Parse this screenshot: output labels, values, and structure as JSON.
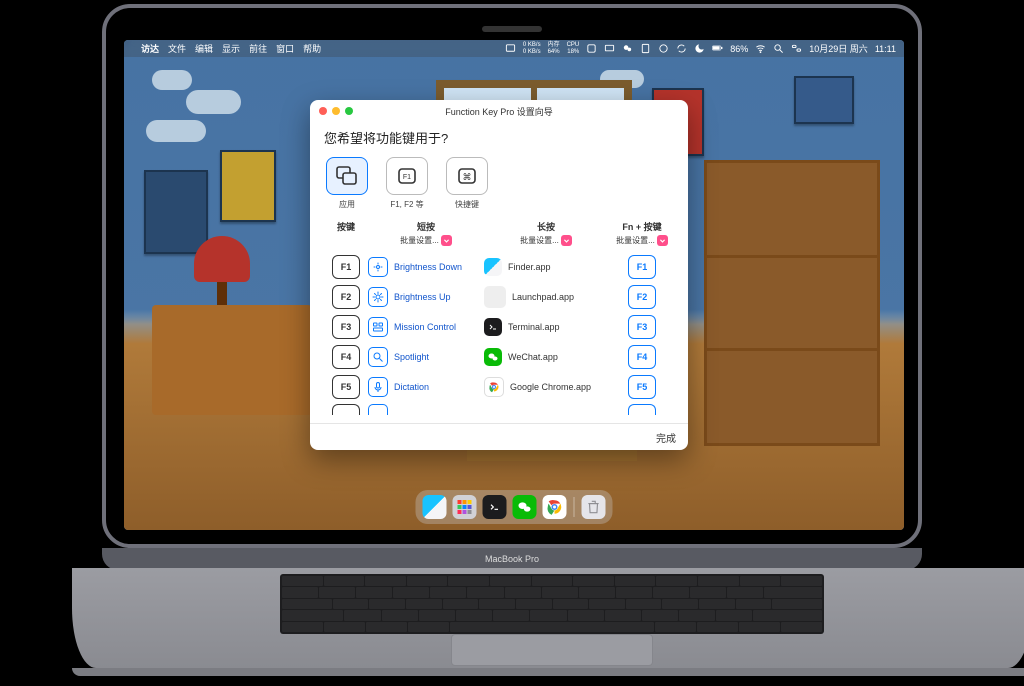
{
  "menubar": {
    "apple": "",
    "app": "访达",
    "items": [
      "文件",
      "编辑",
      "显示",
      "前往",
      "窗口",
      "帮助"
    ],
    "stats": {
      "net": {
        "up": "0 KB/s",
        "down": "0 KB/s"
      },
      "mem": {
        "label": "内存",
        "value": "64%"
      },
      "cpu": {
        "label": "CPU",
        "value": "18%"
      }
    },
    "battery": "86%",
    "date": "10月29日 周六",
    "time": "11:11"
  },
  "window": {
    "title": "Function Key Pro 设置向导",
    "heading": "您希望将功能键用于?",
    "modes": [
      {
        "label": "应用",
        "selected": true
      },
      {
        "label": "F1, F2 等"
      },
      {
        "label": "快捷键"
      }
    ],
    "columns": {
      "key": "按键",
      "short": "短按",
      "long": "长按",
      "fn": "Fn + 按键"
    },
    "batch_label": "批量设置...",
    "rows": [
      {
        "key": "F1",
        "short": "Brightness Down",
        "long": "Finder.app",
        "long_icon": "finder",
        "fn": "F1"
      },
      {
        "key": "F2",
        "short": "Brightness Up",
        "long": "Launchpad.app",
        "long_icon": "launchpad",
        "fn": "F2"
      },
      {
        "key": "F3",
        "short": "Mission Control",
        "long": "Terminal.app",
        "long_icon": "terminal",
        "fn": "F3"
      },
      {
        "key": "F4",
        "short": "Spotlight",
        "long": "WeChat.app",
        "long_icon": "wechat",
        "fn": "F4"
      },
      {
        "key": "F5",
        "short": "Dictation",
        "long": "Google Chrome.app",
        "long_icon": "chrome",
        "fn": "F5"
      }
    ],
    "done": "完成"
  },
  "dock": {
    "items": [
      {
        "name": "finder",
        "bg": "#0a84ff"
      },
      {
        "name": "launchpad",
        "bg": "#8e8e93"
      },
      {
        "name": "terminal",
        "bg": "#1c1c1e"
      },
      {
        "name": "wechat",
        "bg": "#09bb07"
      },
      {
        "name": "chrome",
        "bg": "#ffffff"
      },
      {
        "name": "trash",
        "bg": "#d1d1d6"
      }
    ]
  },
  "laptop_model": "MacBook Pro"
}
